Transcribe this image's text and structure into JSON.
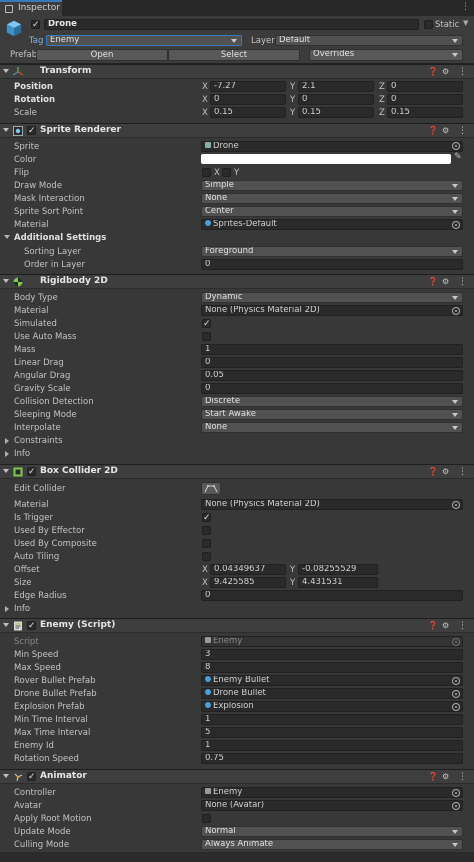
{
  "tab": {
    "label": "Inspector"
  },
  "header": {
    "name": "Drone",
    "static_label": "Static",
    "tag_label": "Tag",
    "tag_value": "Enemy",
    "layer_label": "Layer",
    "layer_value": "Default",
    "prefab_label": "Prefab",
    "open": "Open",
    "select": "Select",
    "overrides": "Overrides"
  },
  "transform": {
    "title": "Transform",
    "position_label": "Position",
    "rotation_label": "Rotation",
    "scale_label": "Scale",
    "position": {
      "x": "-7.27",
      "y": "2.1",
      "z": "0"
    },
    "rotation": {
      "x": "0",
      "y": "0",
      "z": "0"
    },
    "scale": {
      "x": "0.15",
      "y": "0.15",
      "z": "0.15"
    }
  },
  "axes": {
    "x": "X",
    "y": "Y",
    "z": "Z"
  },
  "sprite_renderer": {
    "title": "Sprite Renderer",
    "sprite_label": "Sprite",
    "sprite_value": "Drone",
    "color_label": "Color",
    "color_value": "#ffffff",
    "flip_label": "Flip",
    "flip_x": "X",
    "flip_y": "Y",
    "draw_mode_label": "Draw Mode",
    "draw_mode": "Simple",
    "mask_label": "Mask Interaction",
    "mask": "None",
    "sort_point_label": "Sprite Sort Point",
    "sort_point": "Center",
    "material_label": "Material",
    "material": "Sprites-Default",
    "additional_label": "Additional Settings",
    "sorting_layer_label": "Sorting Layer",
    "sorting_layer": "Foreground",
    "order_label": "Order in Layer",
    "order": "0"
  },
  "rigidbody": {
    "title": "Rigidbody 2D",
    "body_type_label": "Body Type",
    "body_type": "Dynamic",
    "material_label": "Material",
    "material": "None (Physics Material 2D)",
    "simulated_label": "Simulated",
    "auto_mass_label": "Use Auto Mass",
    "mass_label": "Mass",
    "mass": "1",
    "linear_drag_label": "Linear Drag",
    "linear_drag": "0",
    "angular_drag_label": "Angular Drag",
    "angular_drag": "0.05",
    "gravity_label": "Gravity Scale",
    "gravity": "0",
    "collision_label": "Collision Detection",
    "collision": "Discrete",
    "sleeping_label": "Sleeping Mode",
    "sleeping": "Start Awake",
    "interpolate_label": "Interpolate",
    "interpolate": "None",
    "constraints_label": "Constraints",
    "info_label": "Info"
  },
  "box_collider": {
    "title": "Box Collider 2D",
    "edit_label": "Edit Collider",
    "material_label": "Material",
    "material": "None (Physics Material 2D)",
    "trigger_label": "Is Trigger",
    "effector_label": "Used By Effector",
    "composite_label": "Used By Composite",
    "tiling_label": "Auto Tiling",
    "offset_label": "Offset",
    "offset_x": "0.04349637",
    "offset_y": "-0.08255529",
    "size_label": "Size",
    "size_x": "9.425585",
    "size_y": "4.431531",
    "edge_label": "Edge Radius",
    "edge": "0",
    "info_label": "Info"
  },
  "enemy": {
    "title": "Enemy (Script)",
    "script_label": "Script",
    "script": "Enemy",
    "min_speed_label": "Min Speed",
    "min_speed": "3",
    "max_speed_label": "Max Speed",
    "max_speed": "8",
    "rover_label": "Rover Bullet Prefab",
    "rover": "Enemy Bullet",
    "drone_label": "Drone Bullet Prefab",
    "drone": "Drone Bullet",
    "explosion_label": "Explosion Prefab",
    "explosion": "Explosion",
    "min_time_label": "Min Time Interval",
    "min_time": "1",
    "max_time_label": "Max Time Interval",
    "max_time": "5",
    "enemy_id_label": "Enemy Id",
    "enemy_id": "1",
    "rotation_speed_label": "Rotation Speed",
    "rotation_speed": "0.75"
  },
  "animator": {
    "title": "Animator",
    "controller_label": "Controller",
    "controller": "Enemy",
    "avatar_label": "Avatar",
    "avatar": "None (Avatar)",
    "root_motion_label": "Apply Root Motion",
    "update_label": "Update Mode",
    "update": "Normal",
    "culling_label": "Culling Mode",
    "culling": "Always Animate"
  },
  "colors": {
    "accent": "#3a79bb",
    "background": "#383838"
  }
}
